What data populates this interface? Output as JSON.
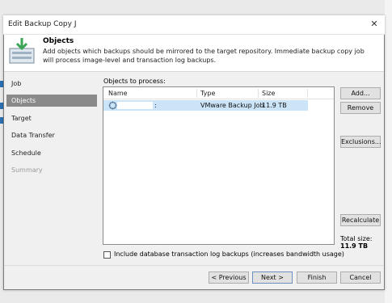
{
  "window": {
    "title": "Edit Backup Copy J",
    "close_glyph": "✕"
  },
  "header": {
    "title": "Objects",
    "description": "Add objects which backups should be mirrored to the target repository. Immediate backup copy job will process image-level and transaction log backups."
  },
  "nav": {
    "items": [
      {
        "label": "Job",
        "state": "normal"
      },
      {
        "label": "Objects",
        "state": "active"
      },
      {
        "label": "Target",
        "state": "normal"
      },
      {
        "label": "Data Transfer",
        "state": "normal"
      },
      {
        "label": "Schedule",
        "state": "normal"
      },
      {
        "label": "Summary",
        "state": "disabled"
      }
    ]
  },
  "objects": {
    "label": "Objects to process:",
    "columns": [
      "Name",
      "Type",
      "Size"
    ],
    "rows": [
      {
        "name": ":",
        "type": "VMware Backup Job",
        "size": "11.9 TB",
        "icon": "backup-job-icon",
        "selected": true
      }
    ]
  },
  "side_buttons": {
    "add": "Add...",
    "remove": "Remove",
    "exclusions": "Exclusions...",
    "recalculate": "Recalculate"
  },
  "total": {
    "label": "Total size:",
    "value": "11.9 TB"
  },
  "option": {
    "label": "Include database transaction log backups (increases bandwidth usage)",
    "checked": false
  },
  "footer": {
    "previous": "< Previous",
    "next": "Next >",
    "finish": "Finish",
    "cancel": "Cancel"
  },
  "colors": {
    "accent_green": "#3aa655",
    "selected_row": "#cce4f7",
    "active_nav": "#8a8a8a"
  }
}
